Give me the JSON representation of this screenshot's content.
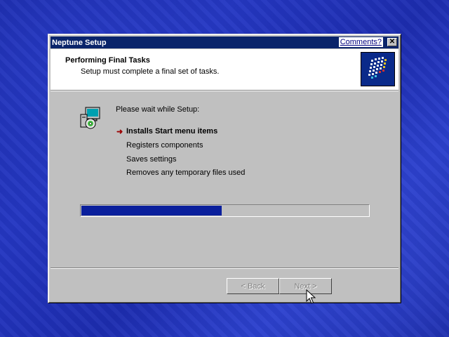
{
  "window": {
    "title": "Neptune Setup",
    "comments_link": "Comments?",
    "close_glyph": "✕"
  },
  "header": {
    "title": "Performing Final Tasks",
    "subtitle": "Setup must complete a final set of tasks."
  },
  "main": {
    "wait_text": "Please wait while Setup:",
    "current_marker": "➜",
    "tasks": [
      {
        "label": "Installs Start menu items",
        "state": "current"
      },
      {
        "label": "Registers components",
        "state": "pending"
      },
      {
        "label": "Saves settings",
        "state": "pending"
      },
      {
        "label": "Removes any temporary files used",
        "state": "pending"
      }
    ],
    "progress_fraction": 0.49
  },
  "buttons": {
    "back_label": "< Back",
    "next_label": "Next >",
    "back_enabled": false,
    "next_enabled": false
  },
  "colors": {
    "titlebar": "#0a246a",
    "progress_fill": "#0a1f9c",
    "current_arrow": "#9b0000",
    "desktop": "#2437c2"
  }
}
